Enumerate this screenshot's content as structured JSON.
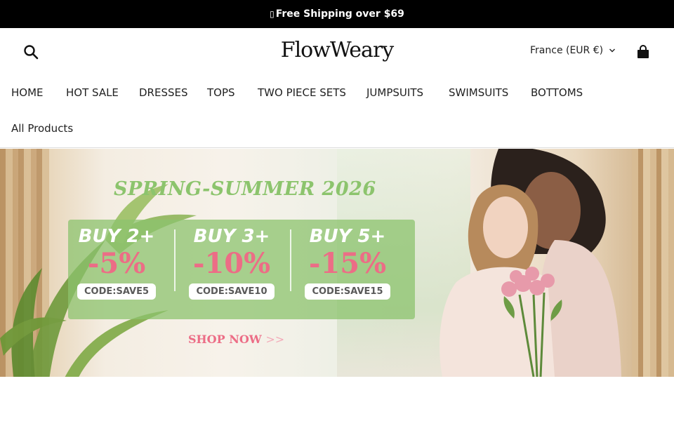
{
  "announcement": {
    "icon": "gift-icon",
    "text": "Free Shipping over $69"
  },
  "header": {
    "logo": "FlowWeary",
    "currency": "France (EUR €)",
    "search_icon": "search-icon",
    "cart_icon": "shopping-bag-icon"
  },
  "nav": {
    "items": [
      {
        "label": "HOME"
      },
      {
        "label": "HOT SALE"
      },
      {
        "label": "DRESSES"
      },
      {
        "label": "TOPS"
      },
      {
        "label": "TWO PIECE SETS"
      },
      {
        "label": "JUMPSUITS"
      },
      {
        "label": "SWIMSUITS"
      },
      {
        "label": "BOTTOMS"
      },
      {
        "label": "All Products"
      }
    ]
  },
  "hero": {
    "title": "SPRING-SUMMER 2026",
    "tiers": [
      {
        "buy": "BUY 2+",
        "discount": "-5%",
        "code": "CODE:SAVE5"
      },
      {
        "buy": "BUY 3+",
        "discount": "-10%",
        "code": "CODE:SAVE10"
      },
      {
        "buy": "BUY 5+",
        "discount": "-15%",
        "code": "CODE:SAVE15"
      }
    ],
    "cta": "SHOP NOW",
    "cta_arrows": ">>"
  },
  "colors": {
    "announcement_bg": "#000000",
    "promo_green": "#8cc46d",
    "discount_pink": "#ec6d86"
  }
}
